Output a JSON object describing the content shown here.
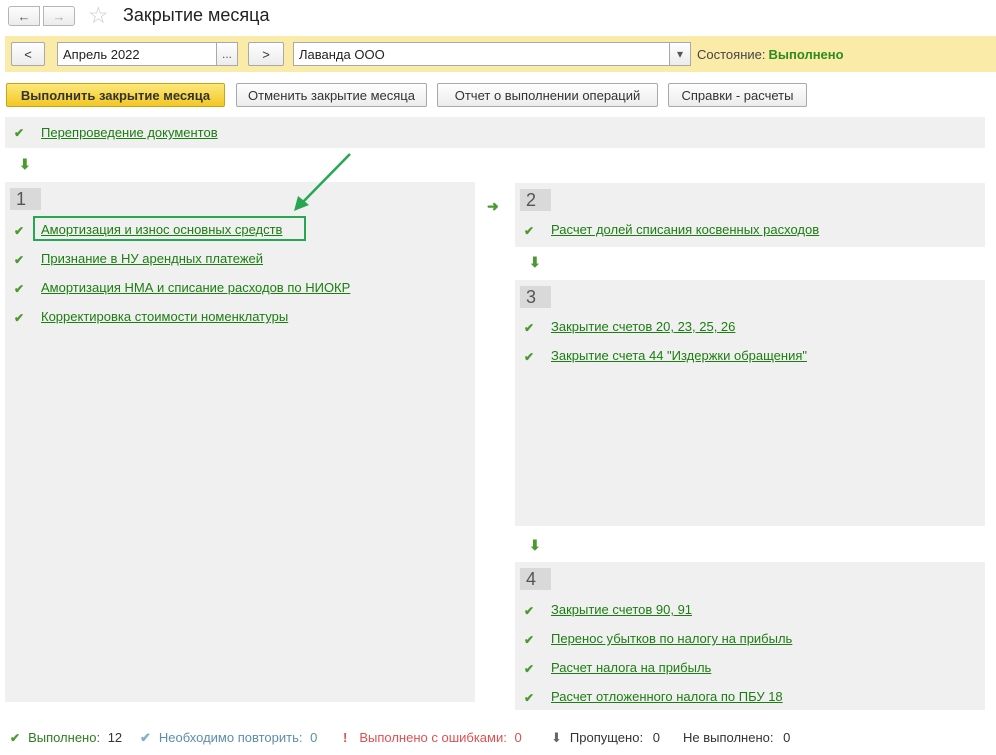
{
  "header": {
    "back_icon": "←",
    "forward_icon": "→",
    "star_icon": "☆",
    "title": "Закрытие месяца"
  },
  "filters": {
    "prev_label": "<",
    "period": "Апрель 2022",
    "ellipsis": "...",
    "next_label": ">",
    "organization": "Лаванда ООО",
    "dropdown_icon": "▾",
    "status_label": "Состояние:",
    "status_value": "Выполнено"
  },
  "toolbar": {
    "run_label": "Выполнить закрытие месяца",
    "cancel_label": "Отменить закрытие месяца",
    "report_label": "Отчет о выполнении операций",
    "help_label": "Справки - расчеты"
  },
  "check_icon": "✔",
  "pre_step": {
    "link": "Перепроведение документов"
  },
  "stages": [
    {
      "number": "1",
      "items": [
        "Амортизация и износ основных средств",
        "Признание в НУ арендных платежей",
        "Амортизация НМА и списание расходов по НИОКР",
        "Корректировка стоимости номенклатуры"
      ]
    },
    {
      "number": "2",
      "items": [
        "Расчет долей списания косвенных расходов"
      ]
    },
    {
      "number": "3",
      "items": [
        "Закрытие счетов 20, 23, 25, 26",
        "Закрытие счета 44 \"Издержки обращения\""
      ]
    },
    {
      "number": "4",
      "items": [
        "Закрытие счетов 90, 91",
        "Перенос убытков по налогу на прибыль",
        "Расчет налога на прибыль",
        "Расчет отложенного налога по ПБУ 18"
      ]
    }
  ],
  "legend": {
    "done_label": "Выполнено:",
    "done_count": "12",
    "repeat_label": "Необходимо повторить:",
    "repeat_count": "0",
    "errors_icon": "!",
    "errors_label": "Выполнено с ошибками:",
    "errors_count": "0",
    "skipped_icon": "⬇",
    "skipped_label": "Пропущено:",
    "skipped_count": "0",
    "not_done_label": "Не выполнено:",
    "not_done_count": "0"
  },
  "colors": {
    "filter_bar": "#fbeba8",
    "primary_button": "#f2c724",
    "link": "#1d7d12",
    "check": "#4a9a2e",
    "highlight": "#26a853",
    "status_done": "#2e8b20",
    "repeat": "#5b8fa8",
    "error": "#e05050"
  }
}
